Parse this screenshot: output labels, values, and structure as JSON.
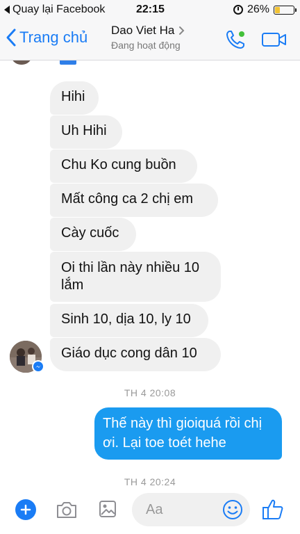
{
  "status_bar": {
    "back_app": "Quay lại Facebook",
    "time": "22:15",
    "battery": "26%",
    "battery_level": 0.26
  },
  "nav": {
    "back_label": "Trang chủ",
    "contact_name": "Dao Viet Ha",
    "contact_status": "Đang hoạt động"
  },
  "messages_in": [
    "Hihi",
    "Uh Hihi",
    "Chu Ko cung buồn",
    "Mất công ca 2 chị em",
    "Cày cuốc",
    "Oi thi lần này nhiều 10 lắm",
    "Sinh 10, dịa 10, ly 10",
    "Giáo dục cong dân 10"
  ],
  "timestamps": [
    "TH 4 20:08",
    "TH 4 20:24"
  ],
  "message_out": "Thế này thì gioiquá rồi chị ơi. Lại toe toét hehe",
  "composer": {
    "placeholder": "Aa"
  },
  "colors": {
    "accent": "#1a7cf5",
    "bubble_in": "#f0f0f0",
    "bubble_out": "#1a9bf0"
  },
  "icons": [
    "back-chevron-icon",
    "phone-icon",
    "video-camera-icon",
    "plus-icon",
    "camera-icon",
    "photo-icon",
    "emoji-icon",
    "thumbs-up-icon",
    "alarm-icon",
    "battery-icon"
  ]
}
